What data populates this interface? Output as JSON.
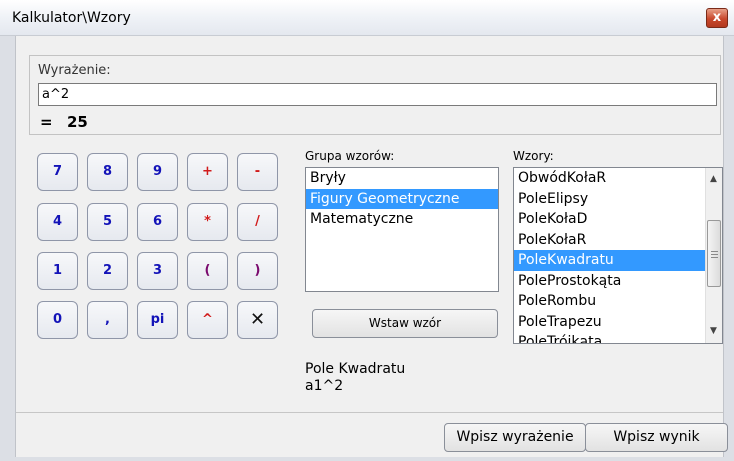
{
  "window": {
    "title": "Kalkulator\\Wzory",
    "close_label": "x"
  },
  "expression": {
    "label": "Wyrażenie:",
    "value": "a^2",
    "equals_sign": "=",
    "result": "25"
  },
  "keypad": [
    {
      "label": "7",
      "name": "key-7",
      "color": "blue"
    },
    {
      "label": "8",
      "name": "key-8",
      "color": "blue"
    },
    {
      "label": "9",
      "name": "key-9",
      "color": "blue"
    },
    {
      "label": "+",
      "name": "key-plus",
      "color": "red"
    },
    {
      "label": "-",
      "name": "key-minus",
      "color": "red"
    },
    {
      "label": "4",
      "name": "key-4",
      "color": "blue"
    },
    {
      "label": "5",
      "name": "key-5",
      "color": "blue"
    },
    {
      "label": "6",
      "name": "key-6",
      "color": "blue"
    },
    {
      "label": "*",
      "name": "key-multiply",
      "color": "red"
    },
    {
      "label": "/",
      "name": "key-divide",
      "color": "red"
    },
    {
      "label": "1",
      "name": "key-1",
      "color": "blue"
    },
    {
      "label": "2",
      "name": "key-2",
      "color": "blue"
    },
    {
      "label": "3",
      "name": "key-3",
      "color": "blue"
    },
    {
      "label": "(",
      "name": "key-open-paren",
      "color": "purple"
    },
    {
      "label": ")",
      "name": "key-close-paren",
      "color": "purple"
    },
    {
      "label": "0",
      "name": "key-0",
      "color": "blue"
    },
    {
      "label": ",",
      "name": "key-comma",
      "color": "blue"
    },
    {
      "label": "pi",
      "name": "key-pi",
      "color": "blue"
    },
    {
      "label": "^",
      "name": "key-power",
      "color": "red"
    },
    {
      "label": "✕",
      "name": "key-clear",
      "color": "black"
    }
  ],
  "groups": {
    "label": "Grupa wzorów:",
    "items": [
      "Bryły",
      "Figury Geometryczne",
      "Matematyczne"
    ],
    "selected_index": 1
  },
  "formulas": {
    "label": "Wzory:",
    "items": [
      "ObwódKołaR",
      "PoleElipsy",
      "PoleKołaD",
      "PoleKołaR",
      "PoleKwadratu",
      "PoleProstokąta",
      "PoleRombu",
      "PoleTrapezu",
      "PoleTrójkąta"
    ],
    "selected_index": 4,
    "scroll_up_icon": "triangle-up-icon",
    "scroll_down_icon": "triangle-down-icon"
  },
  "insert_button": "Wstaw wzór",
  "description": {
    "name": "Pole Kwadratu",
    "formula": "a1^2"
  },
  "footer": {
    "write_expression": "Wpisz wyrażenie",
    "write_result": "Wpisz wynik"
  },
  "colors": {
    "selection": "#3399ff",
    "digit_key": "#1313b8",
    "operator_key": "#d11b1b",
    "paren_key": "#7a0a6e"
  }
}
